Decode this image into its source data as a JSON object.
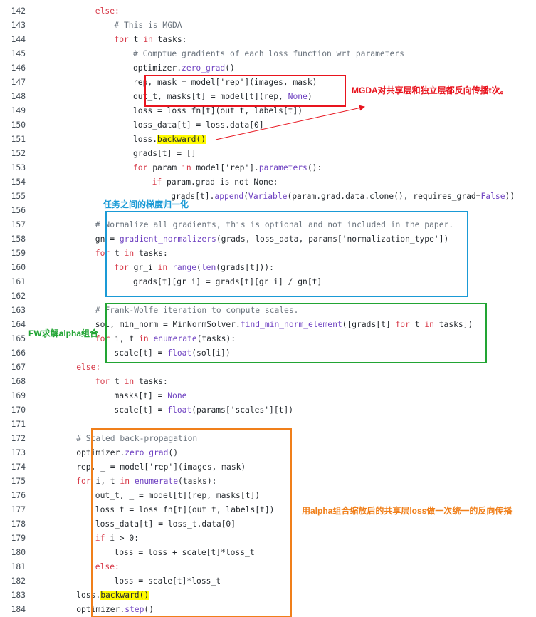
{
  "code_lines": [
    {
      "num": "142",
      "indent": 6,
      "tokens": [
        {
          "t": "else:",
          "c": "kw"
        }
      ]
    },
    {
      "num": "143",
      "indent": 8,
      "tokens": [
        {
          "t": "# This is MGDA",
          "c": "cm"
        }
      ]
    },
    {
      "num": "144",
      "indent": 8,
      "tokens": [
        {
          "t": "for",
          "c": "kw"
        },
        {
          "t": " t "
        },
        {
          "t": "in",
          "c": "kw"
        },
        {
          "t": " tasks:"
        }
      ]
    },
    {
      "num": "145",
      "indent": 10,
      "tokens": [
        {
          "t": "# Comptue gradients of each loss function wrt parameters",
          "c": "cm"
        }
      ]
    },
    {
      "num": "146",
      "indent": 10,
      "tokens": [
        {
          "t": "optimizer."
        },
        {
          "t": "zero_grad",
          "c": "bi"
        },
        {
          "t": "()"
        }
      ]
    },
    {
      "num": "147",
      "indent": 10,
      "tokens": [
        {
          "t": "rep, mask = model['rep'](images, mask)"
        }
      ]
    },
    {
      "num": "148",
      "indent": 10,
      "tokens": [
        {
          "t": "out_t, masks[t] = model[t](rep, "
        },
        {
          "t": "None",
          "c": "bi"
        },
        {
          "t": ")"
        }
      ]
    },
    {
      "num": "149",
      "indent": 10,
      "tokens": [
        {
          "t": "loss = loss_fn[t](out_t, labels[t])"
        }
      ]
    },
    {
      "num": "150",
      "indent": 10,
      "tokens": [
        {
          "t": "loss_data[t] = loss.data[0]"
        }
      ]
    },
    {
      "num": "151",
      "indent": 10,
      "tokens": [
        {
          "t": "loss."
        },
        {
          "t": "backward()",
          "c": "hl"
        }
      ]
    },
    {
      "num": "152",
      "indent": 10,
      "tokens": [
        {
          "t": "grads[t] = []"
        }
      ]
    },
    {
      "num": "153",
      "indent": 10,
      "tokens": [
        {
          "t": "for",
          "c": "kw"
        },
        {
          "t": " param "
        },
        {
          "t": "in",
          "c": "kw"
        },
        {
          "t": " model['rep']."
        },
        {
          "t": "parameters",
          "c": "bi"
        },
        {
          "t": "():"
        }
      ]
    },
    {
      "num": "154",
      "indent": 12,
      "tokens": [
        {
          "t": "if",
          "c": "kw"
        },
        {
          "t": " param.grad is not None:"
        }
      ]
    },
    {
      "num": "155",
      "indent": 14,
      "tokens": [
        {
          "t": "grads[t]."
        },
        {
          "t": "append",
          "c": "bi"
        },
        {
          "t": "("
        },
        {
          "t": "Variable",
          "c": "bi"
        },
        {
          "t": "(param.grad.data.clone(), requires_grad="
        },
        {
          "t": "False",
          "c": "bi"
        },
        {
          "t": "))"
        }
      ]
    },
    {
      "num": "156",
      "indent": 0,
      "tokens": []
    },
    {
      "num": "157",
      "indent": 6,
      "tokens": [
        {
          "t": "# Normalize all gradients, this is optional and not included in the paper.",
          "c": "cm"
        }
      ]
    },
    {
      "num": "158",
      "indent": 6,
      "tokens": [
        {
          "t": "gn = "
        },
        {
          "t": "gradient_normalizers",
          "c": "bi"
        },
        {
          "t": "(grads, loss_data, params['normalization_type'])"
        }
      ]
    },
    {
      "num": "159",
      "indent": 6,
      "tokens": [
        {
          "t": "for",
          "c": "kw"
        },
        {
          "t": " t "
        },
        {
          "t": "in",
          "c": "kw"
        },
        {
          "t": " tasks:"
        }
      ]
    },
    {
      "num": "160",
      "indent": 8,
      "tokens": [
        {
          "t": "for",
          "c": "kw"
        },
        {
          "t": " gr_i "
        },
        {
          "t": "in",
          "c": "kw"
        },
        {
          "t": " "
        },
        {
          "t": "range",
          "c": "bi"
        },
        {
          "t": "("
        },
        {
          "t": "len",
          "c": "bi"
        },
        {
          "t": "(grads[t])):"
        }
      ]
    },
    {
      "num": "161",
      "indent": 10,
      "tokens": [
        {
          "t": "grads[t][gr_i] = grads[t][gr_i] / gn[t]"
        }
      ]
    },
    {
      "num": "162",
      "indent": 0,
      "tokens": []
    },
    {
      "num": "163",
      "indent": 6,
      "tokens": [
        {
          "t": "# Frank-Wolfe iteration to compute scales.",
          "c": "cm"
        }
      ]
    },
    {
      "num": "164",
      "indent": 6,
      "tokens": [
        {
          "t": "sol, min_norm = MinNormSolver."
        },
        {
          "t": "find_min_norm_element",
          "c": "bi"
        },
        {
          "t": "([grads[t] "
        },
        {
          "t": "for",
          "c": "kw"
        },
        {
          "t": " t "
        },
        {
          "t": "in",
          "c": "kw"
        },
        {
          "t": " tasks])"
        }
      ]
    },
    {
      "num": "165",
      "indent": 6,
      "tokens": [
        {
          "t": "for",
          "c": "kw"
        },
        {
          "t": " i, t "
        },
        {
          "t": "in",
          "c": "kw"
        },
        {
          "t": " "
        },
        {
          "t": "enumerate",
          "c": "bi"
        },
        {
          "t": "(tasks):"
        }
      ]
    },
    {
      "num": "166",
      "indent": 8,
      "tokens": [
        {
          "t": "scale[t] = "
        },
        {
          "t": "float",
          "c": "bi"
        },
        {
          "t": "(sol[i])"
        }
      ]
    },
    {
      "num": "167",
      "indent": 4,
      "tokens": [
        {
          "t": "else:",
          "c": "kw"
        }
      ]
    },
    {
      "num": "168",
      "indent": 6,
      "tokens": [
        {
          "t": "for",
          "c": "kw"
        },
        {
          "t": " t "
        },
        {
          "t": "in",
          "c": "kw"
        },
        {
          "t": " tasks:"
        }
      ]
    },
    {
      "num": "169",
      "indent": 8,
      "tokens": [
        {
          "t": "masks[t] = "
        },
        {
          "t": "None",
          "c": "bi"
        }
      ]
    },
    {
      "num": "170",
      "indent": 8,
      "tokens": [
        {
          "t": "scale[t] = "
        },
        {
          "t": "float",
          "c": "bi"
        },
        {
          "t": "(params['scales'][t])"
        }
      ]
    },
    {
      "num": "171",
      "indent": 0,
      "tokens": []
    },
    {
      "num": "172",
      "indent": 4,
      "tokens": [
        {
          "t": "# Scaled back-propagation",
          "c": "cm"
        }
      ]
    },
    {
      "num": "173",
      "indent": 4,
      "tokens": [
        {
          "t": "optimizer."
        },
        {
          "t": "zero_grad",
          "c": "bi"
        },
        {
          "t": "()"
        }
      ]
    },
    {
      "num": "174",
      "indent": 4,
      "tokens": [
        {
          "t": "rep, _ = model['rep'](images, mask)"
        }
      ]
    },
    {
      "num": "175",
      "indent": 4,
      "tokens": [
        {
          "t": "for",
          "c": "kw"
        },
        {
          "t": " i, t "
        },
        {
          "t": "in",
          "c": "kw"
        },
        {
          "t": " "
        },
        {
          "t": "enumerate",
          "c": "bi"
        },
        {
          "t": "(tasks):"
        }
      ]
    },
    {
      "num": "176",
      "indent": 6,
      "tokens": [
        {
          "t": "out_t, _ = model[t](rep, masks[t])"
        }
      ]
    },
    {
      "num": "177",
      "indent": 6,
      "tokens": [
        {
          "t": "loss_t = loss_fn[t](out_t, labels[t])"
        }
      ]
    },
    {
      "num": "178",
      "indent": 6,
      "tokens": [
        {
          "t": "loss_data[t] = loss_t.data[0]"
        }
      ]
    },
    {
      "num": "179",
      "indent": 6,
      "tokens": [
        {
          "t": "if",
          "c": "kw"
        },
        {
          "t": " i > 0:"
        }
      ]
    },
    {
      "num": "180",
      "indent": 8,
      "tokens": [
        {
          "t": "loss = loss + scale[t]*loss_t"
        }
      ]
    },
    {
      "num": "181",
      "indent": 6,
      "tokens": [
        {
          "t": "else:",
          "c": "kw"
        }
      ]
    },
    {
      "num": "182",
      "indent": 8,
      "tokens": [
        {
          "t": "loss = scale[t]*loss_t"
        }
      ]
    },
    {
      "num": "183",
      "indent": 4,
      "tokens": [
        {
          "t": "loss."
        },
        {
          "t": "backward()",
          "c": "hl"
        }
      ]
    },
    {
      "num": "184",
      "indent": 4,
      "tokens": [
        {
          "t": "optimizer."
        },
        {
          "t": "step",
          "c": "bi"
        },
        {
          "t": "()"
        }
      ]
    }
  ],
  "annotations": {
    "mgda_note": "MGDA对共享层和独立层都反向传播t次。",
    "normalize_note": "任务之间的梯度归一化",
    "fw_note": "FW求解alpha组合",
    "scaled_note": "用alpha组合缩放后的共享层loss做一次统一的反向传播"
  },
  "colors": {
    "red": "#e8141e",
    "blue": "#1a9ad6",
    "green": "#22a534",
    "orange": "#f07f1a",
    "keyword": "#d73a49",
    "builtin": "#6f42c1",
    "comment": "#6a737d",
    "highlight": "#fffb00"
  }
}
